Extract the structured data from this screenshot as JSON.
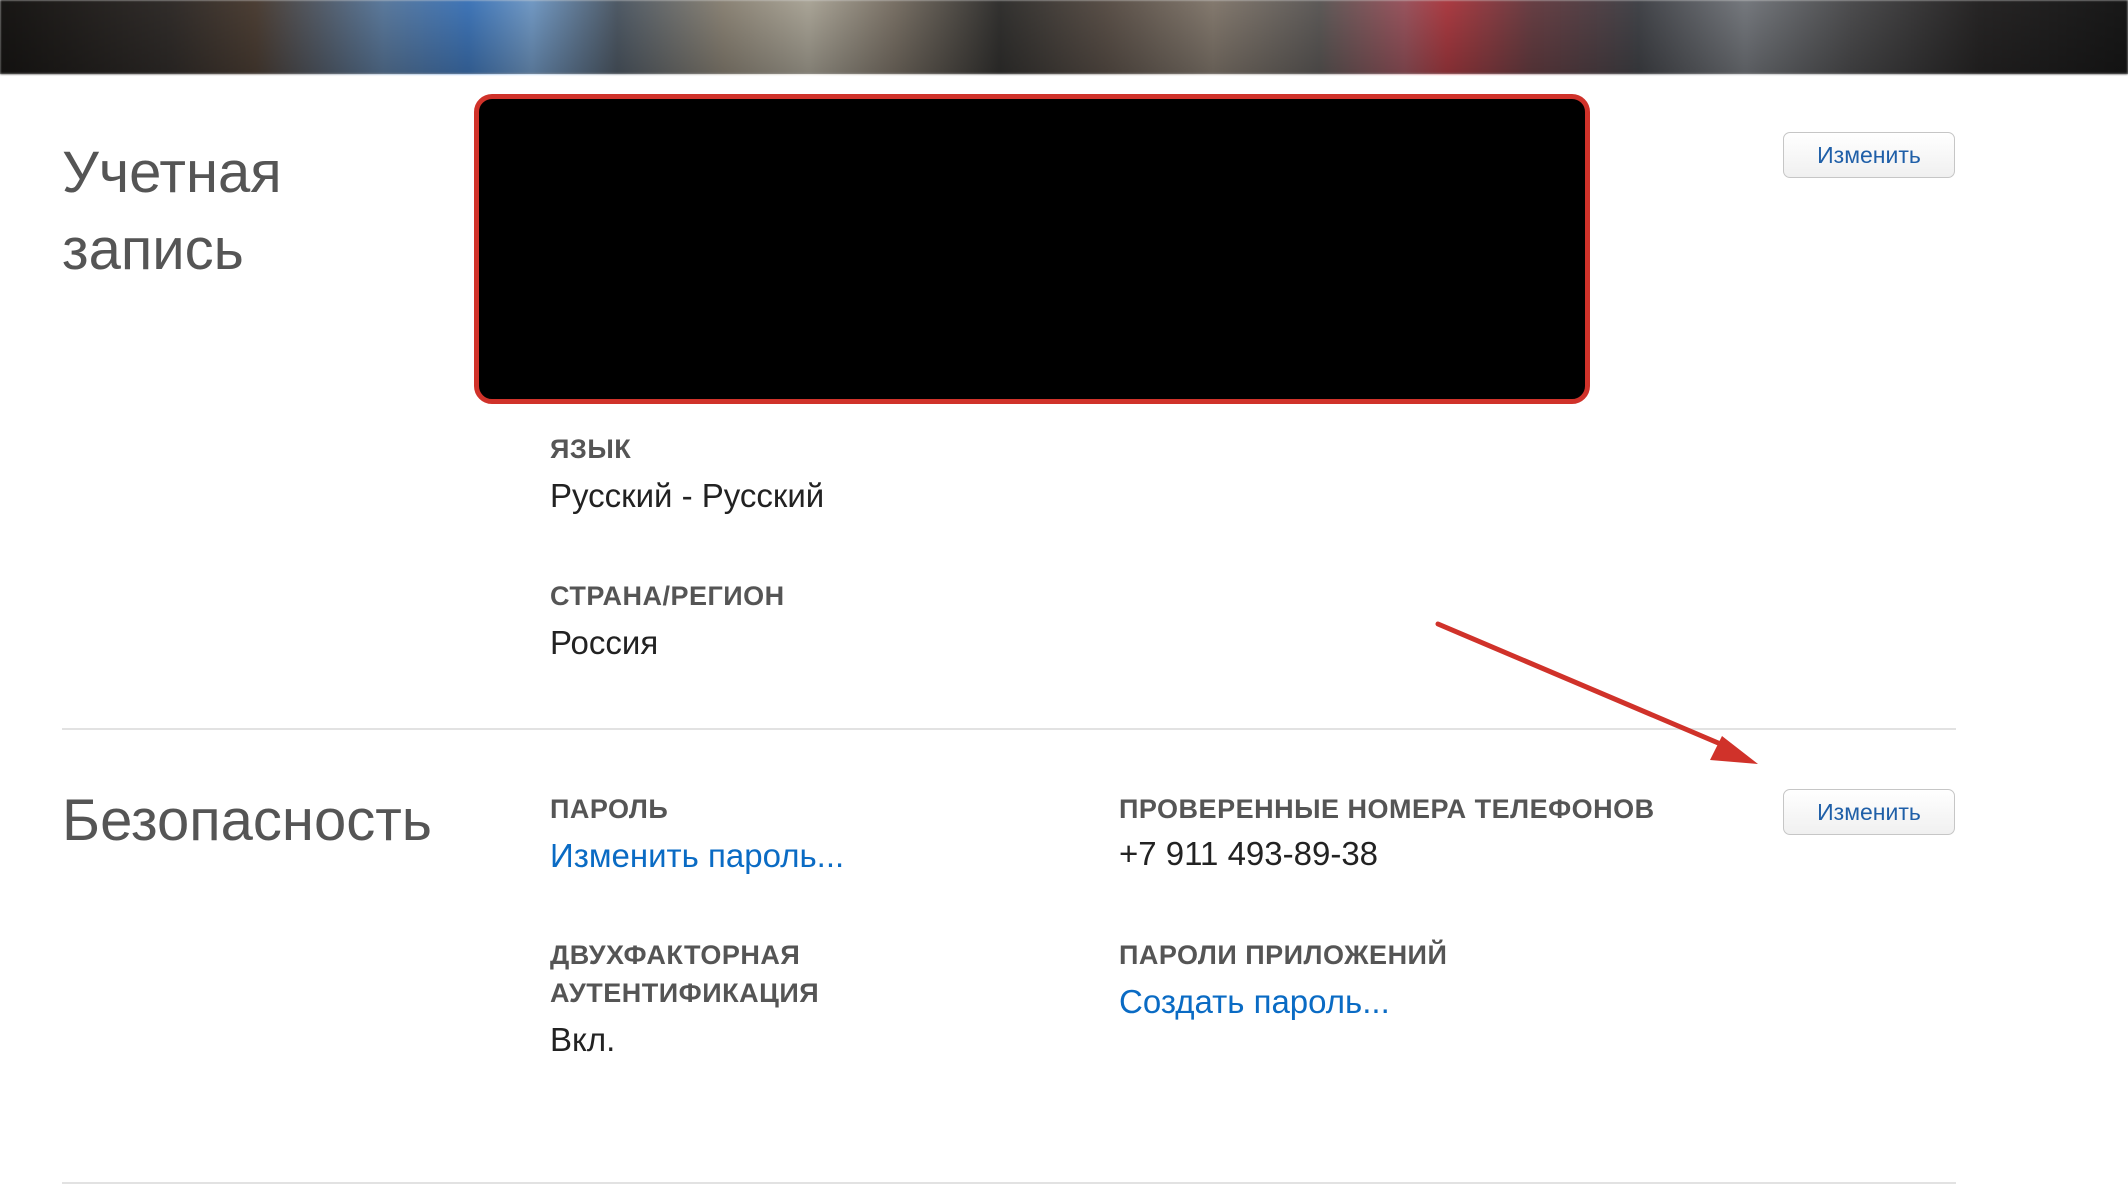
{
  "account": {
    "title": "Учетная запись",
    "edit_label": "Изменить",
    "language_label": "ЯЗЫК",
    "language_value": "Русский - Русский",
    "country_label": "СТРАНА/РЕГИОН",
    "country_value": "Россия"
  },
  "security": {
    "title": "Безопасность",
    "edit_label": "Изменить",
    "password_label": "ПАРОЛЬ",
    "password_link": "Изменить пароль...",
    "phones_label": "ПРОВЕРЕННЫЕ НОМЕРА ТЕЛЕФОНОВ",
    "phone_value": "+7 911 493-89-38",
    "two_factor_label": "ДВУХФАКТОРНАЯ АУТЕНТИФИКАЦИЯ",
    "two_factor_value": "Вкл.",
    "app_passwords_label": "ПАРОЛИ ПРИЛОЖЕНИЙ",
    "app_passwords_link": "Создать пароль..."
  },
  "colors": {
    "link": "#0a6bc4",
    "annotation": "#d0322a",
    "redaction_fill": "#000000"
  }
}
